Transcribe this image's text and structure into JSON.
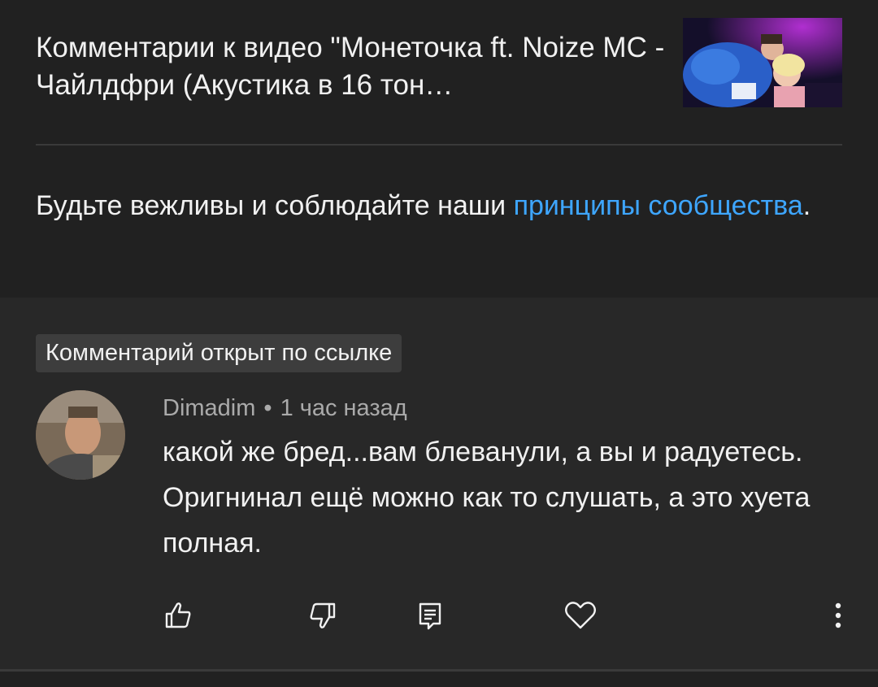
{
  "header": {
    "video_title": "Комментарии к видео \"Монеточка ft. Noize MC - Чайлдфри (Акустика в 16 тон…"
  },
  "guidelines": {
    "text_before": "Будьте вежливы и соблюдайте наши ",
    "link": "принципы сообщества",
    "text_after": "."
  },
  "comment": {
    "badge": "Комментарий открыт по ссылке",
    "author": "Dimadim",
    "separator": "•",
    "time": "1 час назад",
    "text": "какой же бред...вам блеванули, а вы и радуетесь. Оригнинал ещё можно как то слушать, а это хуета полная."
  },
  "actions": {
    "like_icon": "thumb-up-icon",
    "dislike_icon": "thumb-down-icon",
    "reply_icon": "reply-icon",
    "heart_icon": "heart-icon",
    "more_icon": "more-vert-icon"
  },
  "colors": {
    "background": "#212121",
    "comment_background": "#282828",
    "link": "#3ea6ff",
    "secondary_text": "#aaaaaa"
  }
}
